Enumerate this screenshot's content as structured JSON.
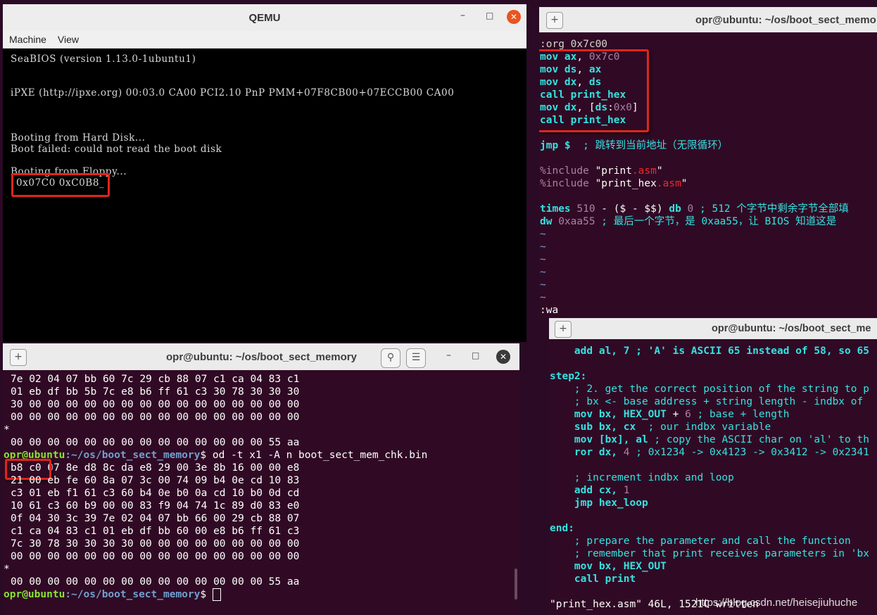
{
  "qemu": {
    "title": "QEMU",
    "menu": [
      "Machine",
      "View"
    ],
    "lines": [
      "SeaBIOS (version 1.13.0-1ubuntu1)",
      "iPXE (http://ipxe.org) 00:03.0 CA00 PCI2.10 PnP PMM+07F8CB00+07ECCB00 CA00",
      "Booting from Hard Disk...",
      "Boot failed: could not read the boot disk",
      "Booting from Floppy...",
      "0x07C0 0xC0B8_"
    ]
  },
  "vim_top": {
    "title": "opr@ubuntu: ~/os/boot_sect_memo",
    "lines": {
      "l0": ":org 0x7c00",
      "l1a": "mov ax",
      "l1b": ", ",
      "l1c": "0x7c0",
      "l2a": "mov ds",
      "l2b": ", ",
      "l2c": "ax",
      "l3a": "mov dx",
      "l3b": ", ",
      "l3c": "ds",
      "l4a": "call print_hex",
      "l5a": "mov dx",
      "l5b": ", [",
      "l5c": "ds",
      "l5d": ":",
      "l5e": "0x0",
      "l5f": "]",
      "l6a": "call print_hex",
      "l8a": "jmp $",
      "l8b": "  ; 跳转到当前地址（无限循环）",
      "l10a": "%include",
      "l10b": " \"print",
      "l10c": ".asm",
      "l10d": "\"",
      "l11a": "%include",
      "l11b": " \"print_hex",
      "l11c": ".asm",
      "l11d": "\"",
      "l13a": "times",
      "l13b": " 510",
      "l13c": " - ($ - $$) ",
      "l13d": "db",
      "l13e": " 0",
      "l13f": " ; 512 个字节中剩余字节全部填",
      "l14a": "dw",
      "l14b": " 0xaa55",
      "l14c": " ; 最后一个字节，是 0xaa55，让 BIOS 知道这是",
      "tilde": "~",
      "cmd": ":wa"
    }
  },
  "vim_bottom": {
    "title": "opr@ubuntu: ~/os/boot_sect_me",
    "lines": {
      "b0": "    add al, 7 ; 'A' is ASCII 65 instead of 58, so 65",
      "b2": "step2:",
      "b3": "    ; 2. get the correct position of the string to p",
      "b4": "    ; bx <- base address + string length - indbx of",
      "b5a": "    mov bx, HEX_OUT",
      "b5b": " + ",
      "b5c": "6",
      "b5d": " ; base + length",
      "b6a": "    sub bx, cx",
      "b6b": "  ; our indbx variable",
      "b7a": "    mov ",
      "b7b": "[bx], al",
      "b7c": " ; copy the ASCII char on 'al' to th",
      "b8a": "    ror dx, ",
      "b8b": "4",
      "b8c": " ; 0x1234 -> 0x4123 -> 0x3412 -> 0x2341",
      "b10": "    ; increment indbx and loop",
      "b11a": "    add cx, ",
      "b11b": "1",
      "b12": "    jmp hex_loop",
      "b14": "end:",
      "b15": "    ; prepare the parameter and call the function",
      "b16": "    ; remember that print receives parameters in 'bx",
      "b17": "    mov bx, HEX_OUT",
      "b18": "    call print",
      "status": "\"print_hex.asm\" 46L, 1521C written",
      "watermark": "https://blog.csdn.net/heisejiuhuche"
    }
  },
  "term": {
    "title": "opr@ubuntu: ~/os/boot_sect_memory",
    "rows": [
      "7e 02 04 07 bb 60 7c 29 cb 88 07 c1 ca 04 83 c1",
      "01 eb df bb 5b 7c e8 b6 ff 61 c3 30 78 30 30 30",
      "30 00 00 00 00 00 00 00 00 00 00 00 00 00 00 00",
      "00 00 00 00 00 00 00 00 00 00 00 00 00 00 00 00",
      "*",
      "00 00 00 00 00 00 00 00 00 00 00 00 00 00 55 aa"
    ],
    "prompt_user": "opr@ubuntu",
    "prompt_path": ":~/os/boot_sect_memory",
    "prompt_sign": "$ ",
    "command": "od -t x1 -A n boot_sect_mem_chk.bin",
    "rows2": [
      "b8 c0 07 8e d8 8c da e8 29 00 3e 8b 16 00 00 e8",
      "21 00 eb fe 60 8a 07 3c 00 74 09 b4 0e cd 10 83",
      "c3 01 eb f1 61 c3 60 b4 0e b0 0a cd 10 b0 0d cd",
      "10 61 c3 60 b9 00 00 83 f9 04 74 1c 89 d0 83 e0",
      "0f 04 30 3c 39 7e 02 04 07 bb 66 00 29 cb 88 07",
      "c1 ca 04 83 c1 01 eb df bb 60 00 e8 b6 ff 61 c3",
      "7c 30 78 30 30 30 30 00 00 00 00 00 00 00 00 00",
      "00 00 00 00 00 00 00 00 00 00 00 00 00 00 00 00",
      "*",
      "00 00 00 00 00 00 00 00 00 00 00 00 00 00 55 aa"
    ]
  }
}
